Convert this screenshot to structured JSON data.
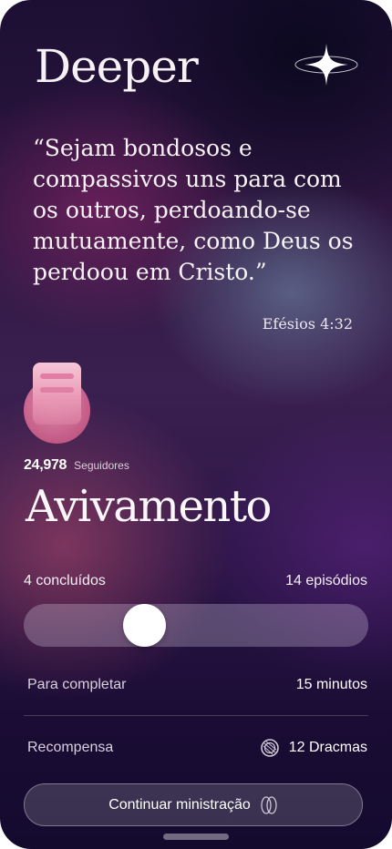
{
  "app": {
    "title": "Deeper",
    "sparkle_icon": "sparkle-icon"
  },
  "verse": {
    "text": "“Sejam bondosos e compassivos uns para com os outros, perdoando-se mutuamente, como Deus os perdoou em Cristo.”",
    "reference": "Efésios 4:32"
  },
  "series": {
    "followers_count": "24,978",
    "followers_label": "Seguidores",
    "title": "Avivamento",
    "completed_label": "4 concluídos",
    "episodes_label": "14 episódios",
    "progress_fraction": 0.33
  },
  "details": {
    "time_label": "Para completar",
    "time_value": "15 minutos",
    "reward_label": "Recompensa",
    "reward_value": "12 Dracmas",
    "reward_icon": "coin-icon"
  },
  "cta": {
    "label": "Continuar ministração",
    "icon": "rings-icon"
  },
  "colors": {
    "cover_pink": "#e996b4",
    "background_dark": "#1c0f33"
  }
}
